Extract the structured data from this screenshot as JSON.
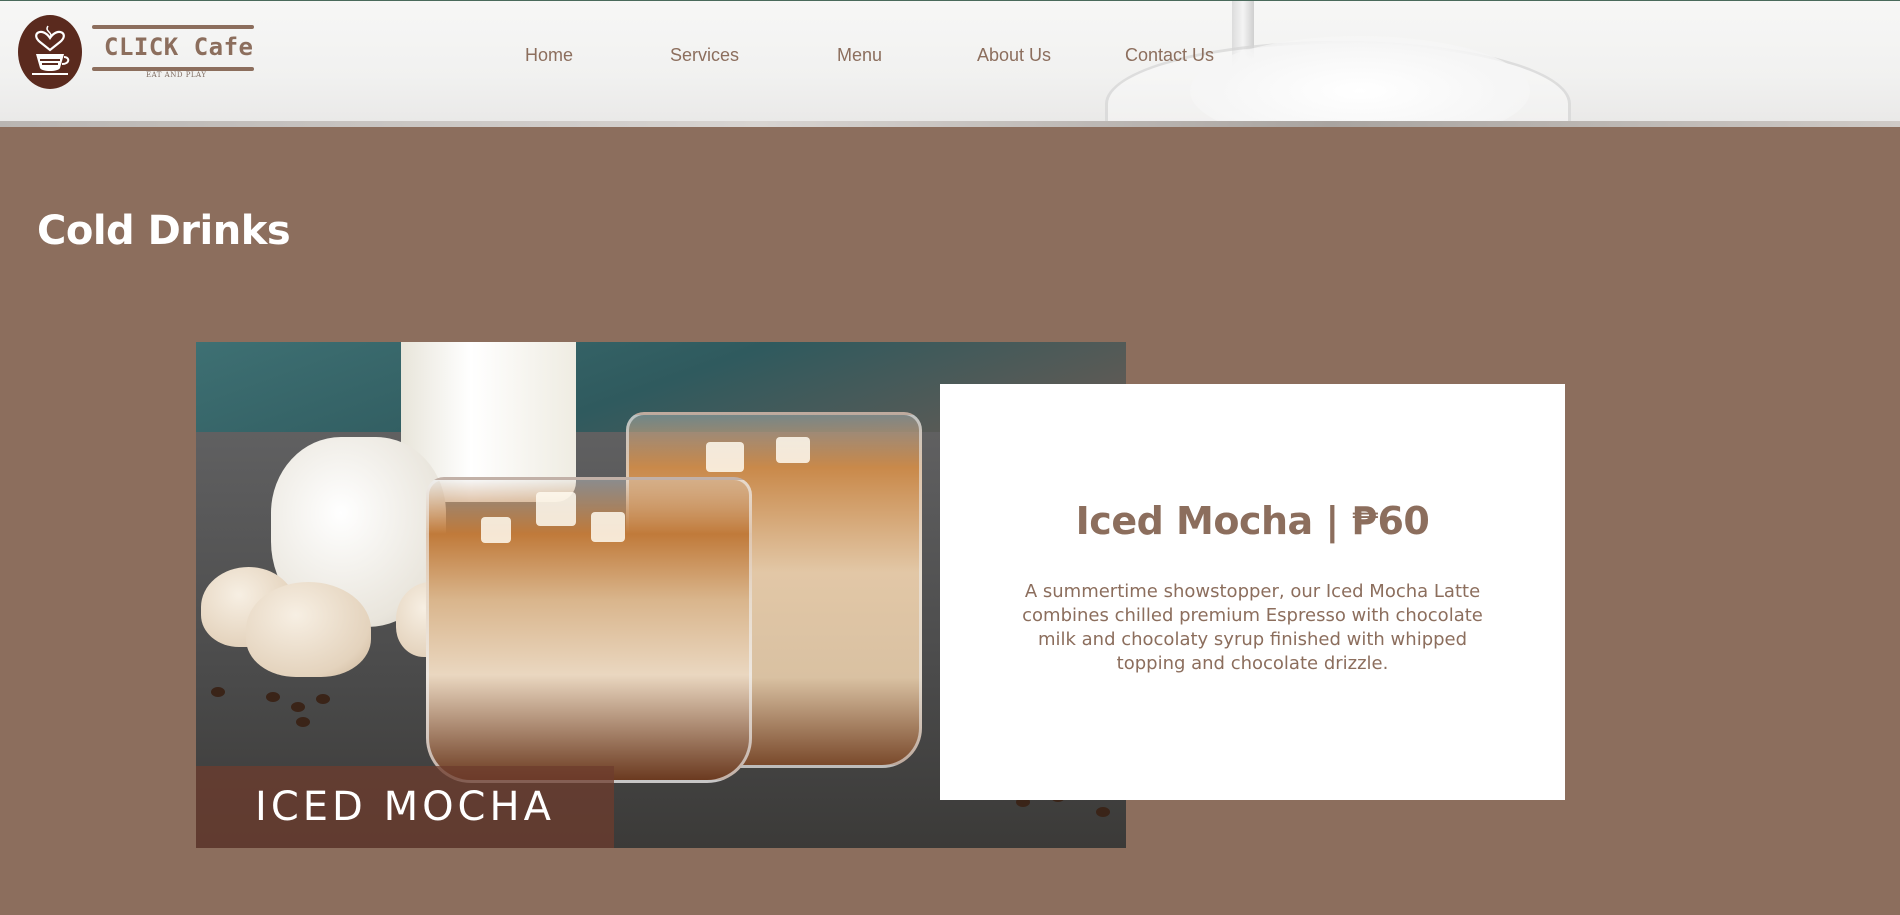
{
  "brand": {
    "name": "CLICK Cafe",
    "tagline": "EAT AND PLAY",
    "logo_icon": "coffee-cup-heart-icon",
    "color_primary": "#8c6e5d",
    "color_logo_badge": "#5a2a1e"
  },
  "nav": {
    "items": [
      {
        "label": "Home"
      },
      {
        "label": "Services"
      },
      {
        "label": "Menu"
      },
      {
        "label": "About Us"
      },
      {
        "label": "Contact Us"
      }
    ]
  },
  "main": {
    "section_title": "Cold Drinks",
    "product": {
      "image_caption": "ICED MOCHA",
      "title": "Iced Mocha | ₱60",
      "description": "A summertime showstopper, our Iced Mocha Latte combines chilled premium Espresso with chocolate milk and chocolaty syrup finished with whipped topping and chocolate drizzle."
    }
  },
  "colors": {
    "page_background": "#8c6e5d",
    "card_background": "#ffffff",
    "heading_on_dark": "#ffffff"
  }
}
